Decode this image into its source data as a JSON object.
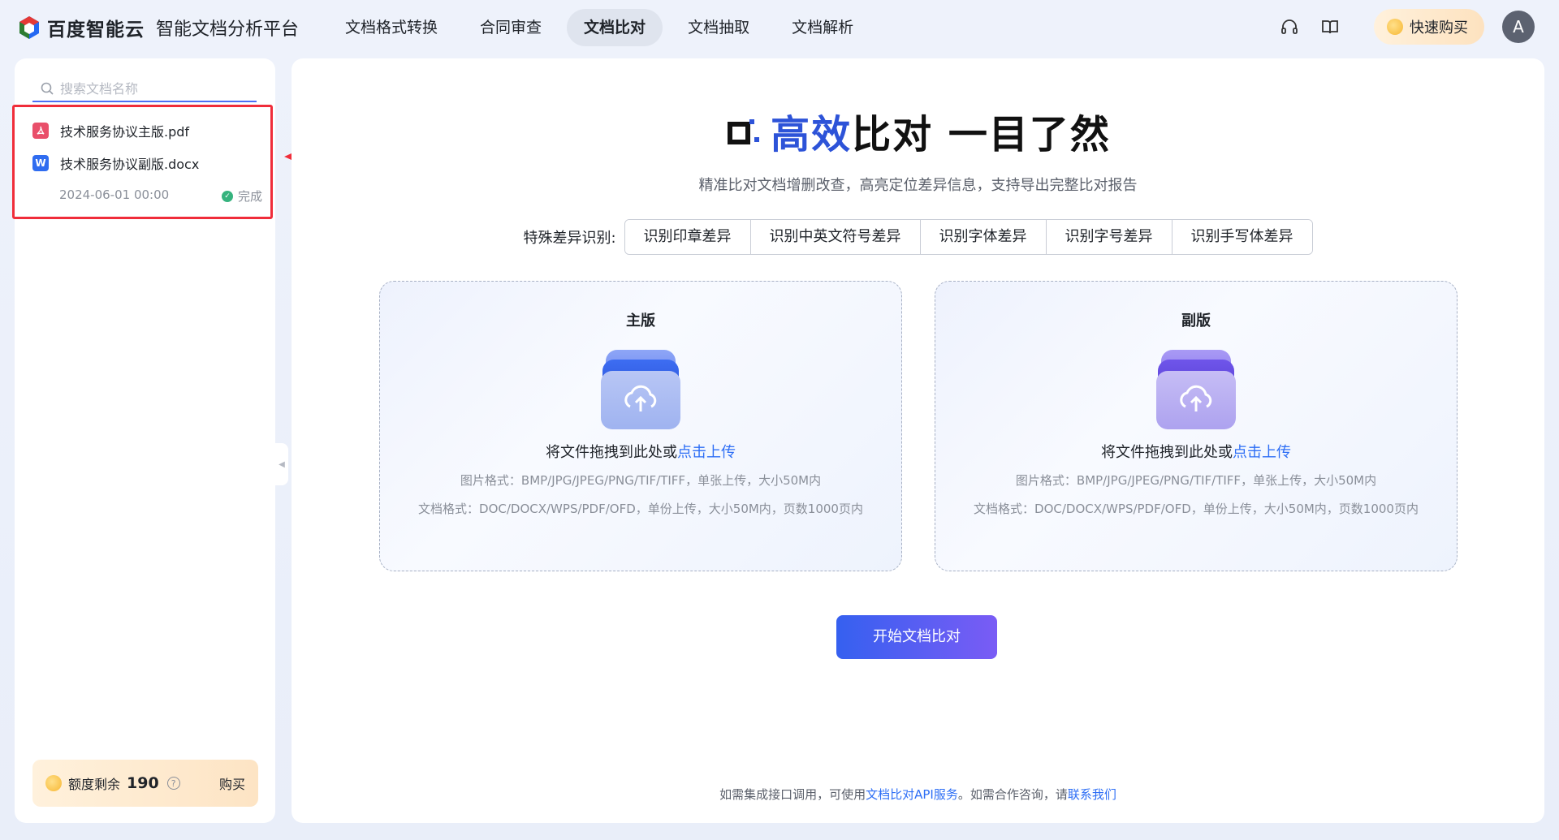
{
  "brand": {
    "name": "百度智能云",
    "subtitle": "智能文档分析平台"
  },
  "nav": {
    "items": [
      {
        "label": "文档格式转换",
        "active": false
      },
      {
        "label": "合同审查",
        "active": false
      },
      {
        "label": "文档比对",
        "active": true
      },
      {
        "label": "文档抽取",
        "active": false
      },
      {
        "label": "文档解析",
        "active": false
      }
    ]
  },
  "topRight": {
    "buy_label": "快速购买",
    "avatar_letter": "A"
  },
  "sidebar": {
    "search_placeholder": "搜索文档名称",
    "files": [
      {
        "name": "技术服务协议主版.pdf",
        "type": "pdf"
      },
      {
        "name": "技术服务协议副版.docx",
        "type": "word"
      }
    ],
    "record_time": "2024-06-01 00:00",
    "record_status": "完成",
    "quota_label": "额度剩余",
    "quota_value": "190",
    "quota_buy": "购买"
  },
  "main": {
    "hero_prefix": "高效",
    "hero_suffix": "比对 一目了然",
    "hero_desc": "精准比对文档增删改查，高亮定位差异信息，支持导出完整比对报告",
    "features_label": "特殊差异识别:",
    "features": [
      "识别印章差异",
      "识别中英文符号差异",
      "识别字体差异",
      "识别字号差异",
      "识别手写体差异"
    ],
    "uploads": [
      {
        "title": "主版",
        "main_text": "将文件拖拽到此处或",
        "link_text": "点击上传",
        "hint_image": "图片格式：BMP/JPG/JPEG/PNG/TIF/TIFF，单张上传，大小50M内",
        "hint_doc": "文档格式：DOC/DOCX/WPS/PDF/OFD，单份上传，大小50M内，页数1000页内"
      },
      {
        "title": "副版",
        "main_text": "将文件拖拽到此处或",
        "link_text": "点击上传",
        "hint_image": "图片格式：BMP/JPG/JPEG/PNG/TIF/TIFF，单张上传，大小50M内",
        "hint_doc": "文档格式：DOC/DOCX/WPS/PDF/OFD，单份上传，大小50M内，页数1000页内"
      }
    ],
    "start_button": "开始文档比对",
    "footer_prefix": "如需集成接口调用，可使用",
    "footer_link1": "文档比对API服务",
    "footer_mid": "。如需合作咨询，请",
    "footer_link2": "联系我们"
  },
  "colors": {
    "accent": "#2d53d8",
    "link": "#2d6ef5",
    "annotation_red": "#f02d3a"
  }
}
